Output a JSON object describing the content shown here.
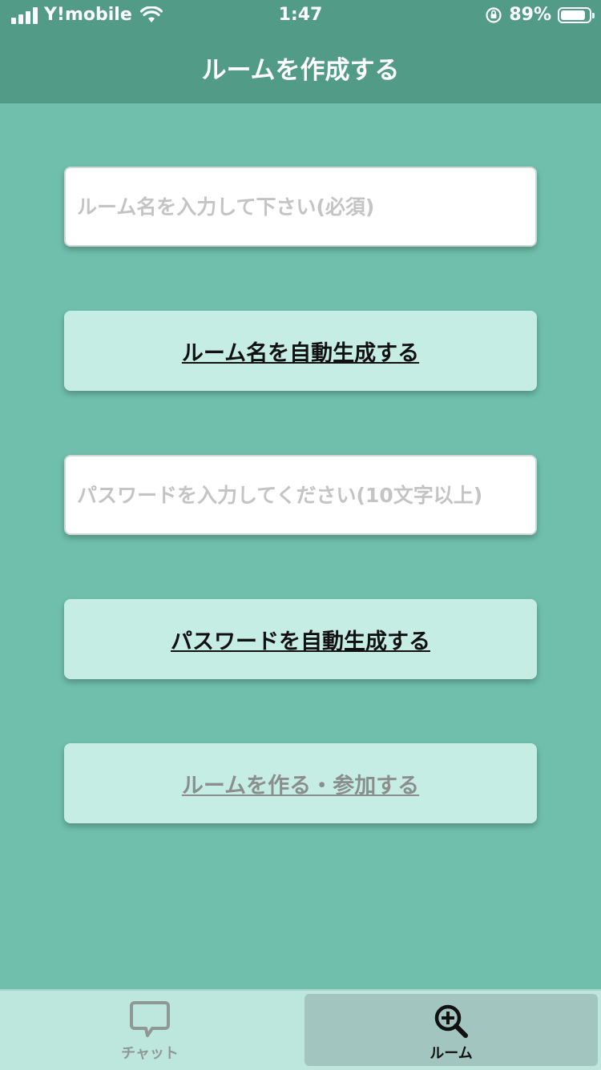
{
  "status_bar": {
    "carrier": "Y!mobile",
    "time": "1:47",
    "battery_percent": "89%",
    "battery_level": 0.89
  },
  "header": {
    "title": "ルームを作成する"
  },
  "form": {
    "room_name_placeholder": "ルーム名を入力して下さい(必須)",
    "room_name_value": "",
    "auto_room_name_label": "ルーム名を自動生成する",
    "password_placeholder": "パスワードを入力してください(10文字以上)",
    "password_value": "",
    "auto_password_label": "パスワードを自動生成する",
    "create_join_label": "ルームを作る・参加する"
  },
  "tab_bar": {
    "tabs": [
      {
        "label": "チャット",
        "icon": "chat-bubble-icon",
        "selected": false
      },
      {
        "label": "ルーム",
        "icon": "search-plus-icon",
        "selected": true
      }
    ]
  },
  "colors": {
    "header": "#529c87",
    "background": "#70bfad",
    "button": "#c6ede4",
    "tab_bar": "#bde6dc",
    "tab_selected": "#a2c6bf"
  }
}
